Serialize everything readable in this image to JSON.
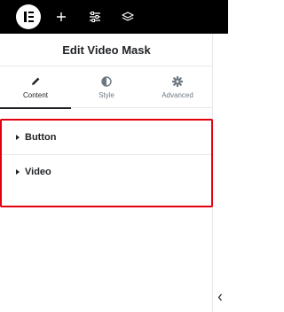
{
  "topbar": {
    "logo_icon": "elementor-logo-icon",
    "buttons": [
      {
        "name": "add-element-button",
        "icon": "plus-icon"
      },
      {
        "name": "site-settings-button",
        "icon": "sliders-icon"
      },
      {
        "name": "structure-button",
        "icon": "layers-icon"
      }
    ]
  },
  "panel": {
    "title": "Edit Video Mask",
    "tabs": [
      {
        "label": "Content",
        "icon": "pencil-icon",
        "active": true
      },
      {
        "label": "Style",
        "icon": "half-circle-icon",
        "active": false
      },
      {
        "label": "Advanced",
        "icon": "gear-icon",
        "active": false
      }
    ],
    "sections": [
      {
        "label": "Button"
      },
      {
        "label": "Video"
      }
    ]
  },
  "collapse_handle_icon": "chevron-left-icon",
  "colors": {
    "topbar_bg": "#000000",
    "highlight_border": "#e3000f",
    "text": "#1f2124",
    "muted_text": "#6d7882"
  }
}
